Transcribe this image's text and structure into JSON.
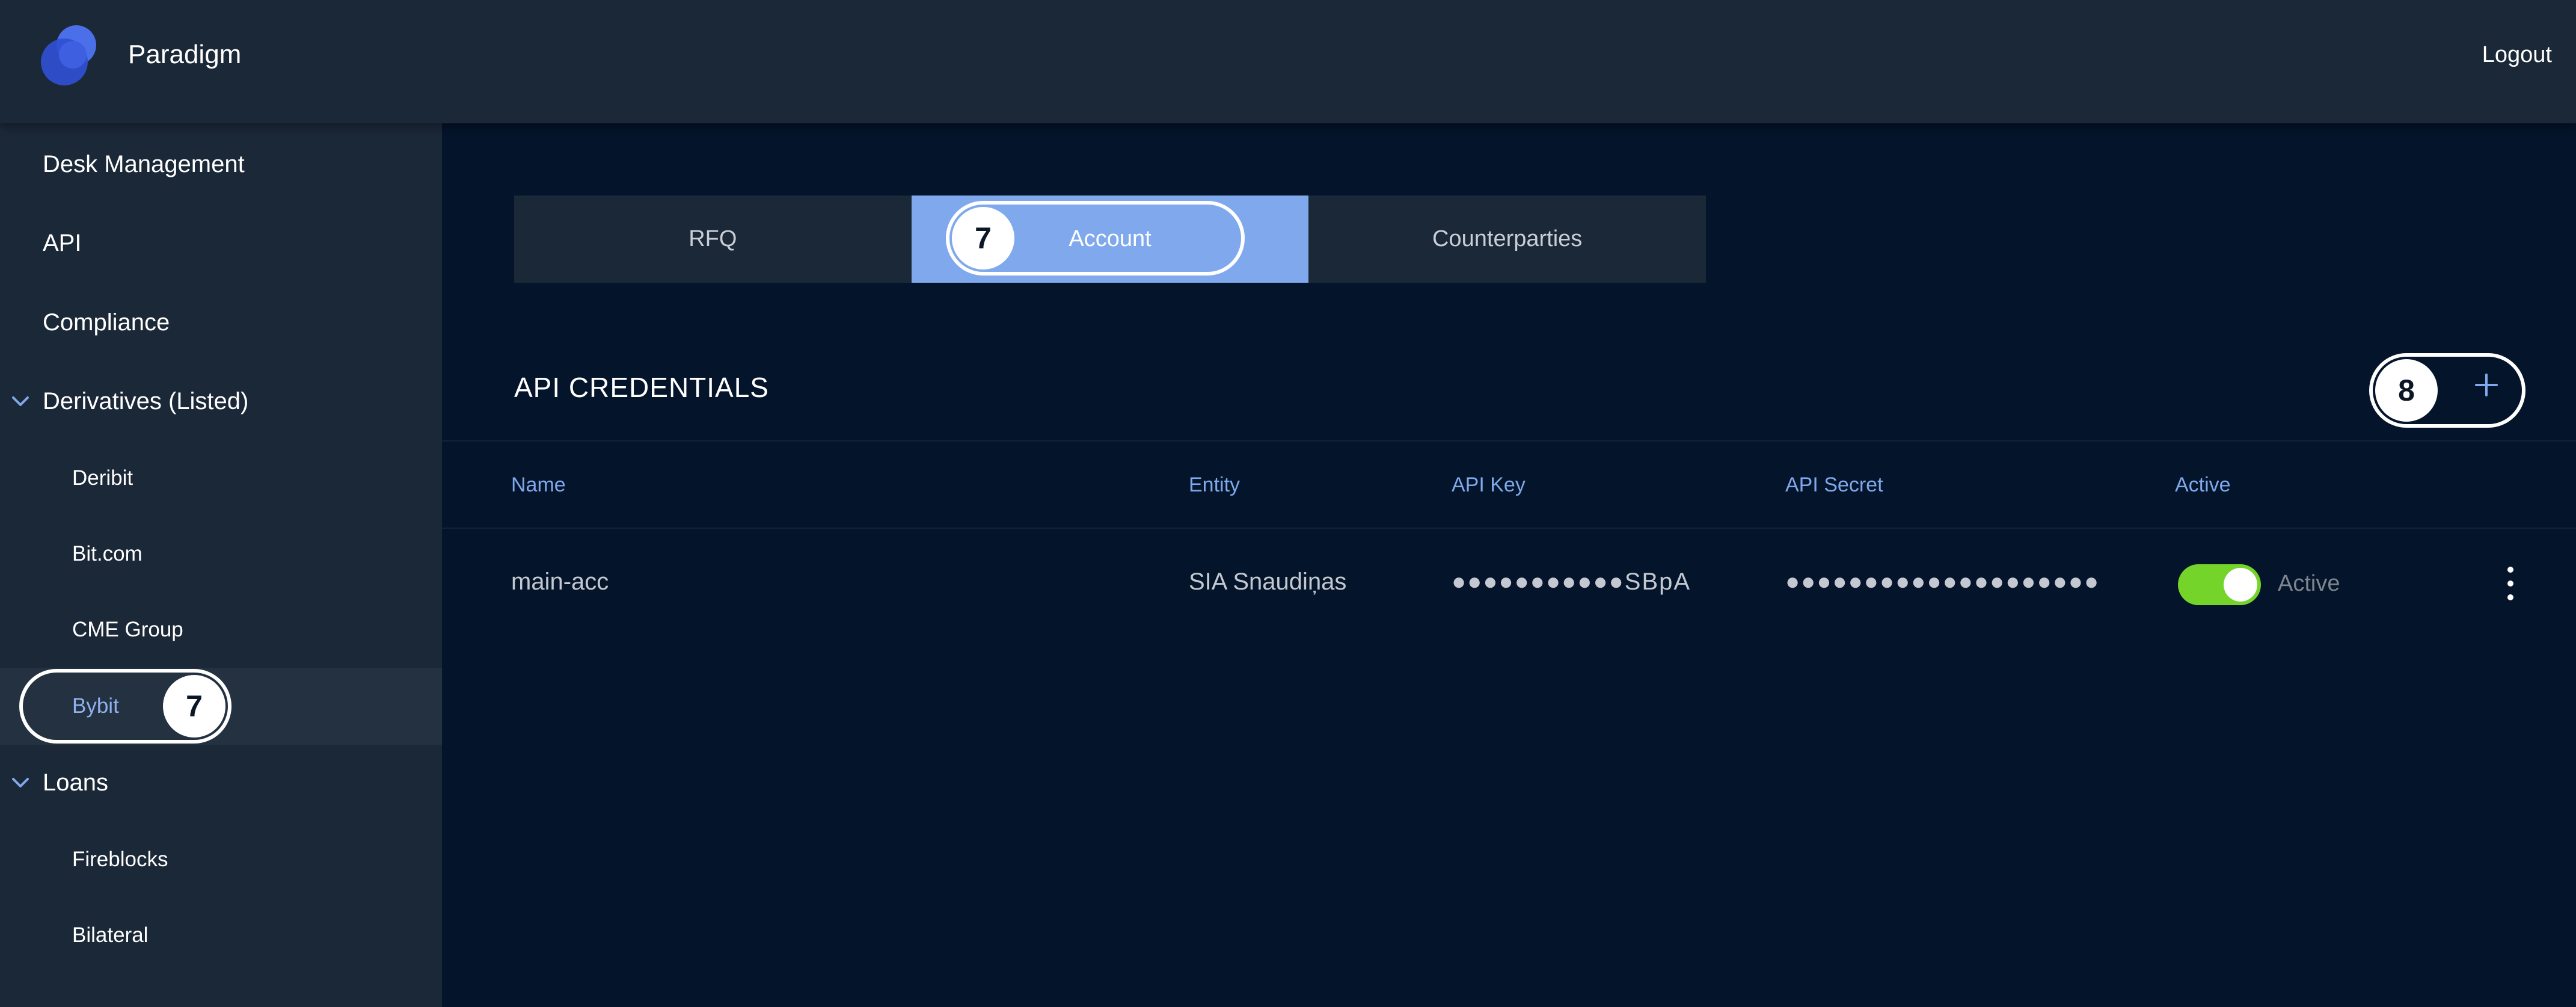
{
  "header": {
    "app_title": "Paradigm",
    "logout_label": "Logout",
    "logo_icon": "paradigm-logo-icon"
  },
  "sidebar": {
    "items": [
      {
        "label": "Desk Management",
        "level": 0
      },
      {
        "label": "API",
        "level": 0
      },
      {
        "label": "Compliance",
        "level": 0
      },
      {
        "label": "Derivatives (Listed)",
        "level": 0,
        "expanded": true
      },
      {
        "label": "Deribit",
        "level": 1
      },
      {
        "label": "Bit.com",
        "level": 1
      },
      {
        "label": "CME Group",
        "level": 1
      },
      {
        "label": "Bybit",
        "level": 1,
        "selected": true
      },
      {
        "label": "Loans",
        "level": 0,
        "expanded": true
      },
      {
        "label": "Fireblocks",
        "level": 1
      },
      {
        "label": "Bilateral",
        "level": 1
      }
    ]
  },
  "tabs": [
    {
      "label": "RFQ",
      "active": false
    },
    {
      "label": "Account",
      "active": true
    },
    {
      "label": "Counterparties",
      "active": false
    }
  ],
  "section": {
    "title": "API CREDENTIALS",
    "add_icon": "plus-icon"
  },
  "table": {
    "columns": [
      "Name",
      "Entity",
      "API Key",
      "API Secret",
      "Active"
    ],
    "rows": [
      {
        "name": "main-acc",
        "entity": "SIA Snaudiņas",
        "api_key": "●●●●●●●●●●●SBpA",
        "api_secret": "●●●●●●●●●●●●●●●●●●●●",
        "active": true,
        "active_label": "Active"
      }
    ]
  },
  "callouts": [
    {
      "number": "7",
      "target": "account-tab"
    },
    {
      "number": "7",
      "target": "sidebar-item-bybit"
    },
    {
      "number": "8",
      "target": "add-credential-button"
    }
  ],
  "colors": {
    "background": "#04142a",
    "panel": "#1b2838",
    "accent": "#7fa9ec",
    "toggle_on": "#74d42a"
  }
}
